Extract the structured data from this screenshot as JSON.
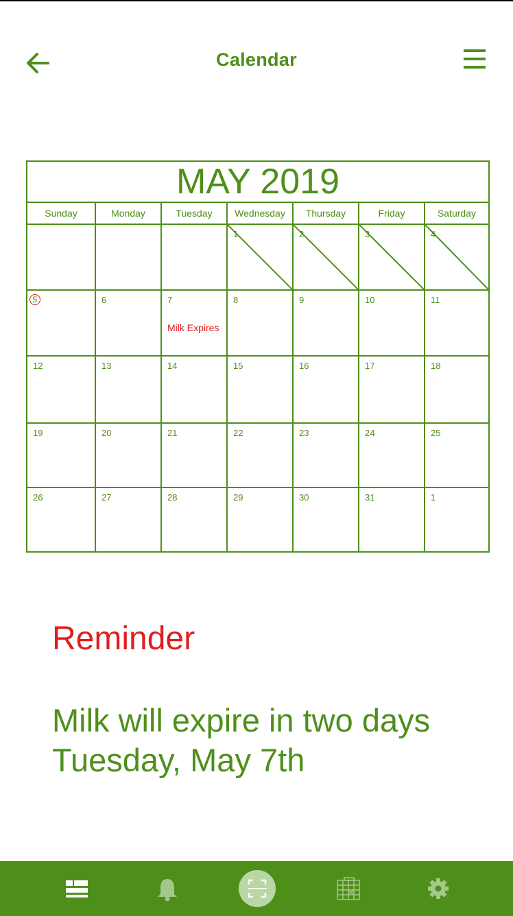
{
  "header": {
    "title": "Calendar"
  },
  "calendar": {
    "month_title": "MAY 2019",
    "weekdays": [
      "Sunday",
      "Monday",
      "Tuesday",
      "Wednesday",
      "Thursday",
      "Friday",
      "Saturday"
    ],
    "weeks": [
      [
        "",
        "",
        "",
        "1",
        "2",
        "3",
        "4"
      ],
      [
        "5",
        "6",
        "7",
        "8",
        "9",
        "10",
        "11"
      ],
      [
        "12",
        "13",
        "14",
        "15",
        "16",
        "17",
        "18"
      ],
      [
        "19",
        "20",
        "21",
        "22",
        "23",
        "24",
        "25"
      ],
      [
        "26",
        "27",
        "28",
        "29",
        "30",
        "31",
        "1"
      ]
    ],
    "event": "Milk Expires"
  },
  "reminder": {
    "title": "Reminder",
    "line1": "Milk will expire in two days",
    "line2": "Tuesday, May 7th"
  },
  "bottom_nav": {
    "items": [
      "list-icon",
      "bell-icon",
      "scan-icon",
      "calendar-icon",
      "gear-icon"
    ]
  },
  "colors": {
    "accent": "#4e8f1a",
    "alert": "#e01e1e"
  }
}
